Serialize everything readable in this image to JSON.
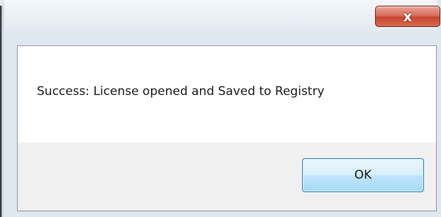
{
  "dialog": {
    "close_glyph": "x",
    "message": "Success: License opened and Saved to Registry",
    "ok_label": "OK"
  },
  "icons": {
    "close": "close-icon"
  },
  "colors": {
    "close_button": "#c9452f",
    "ok_button_border": "#3c7fb1",
    "message_background": "#ffffff",
    "footer_background": "#f0f0f0"
  }
}
